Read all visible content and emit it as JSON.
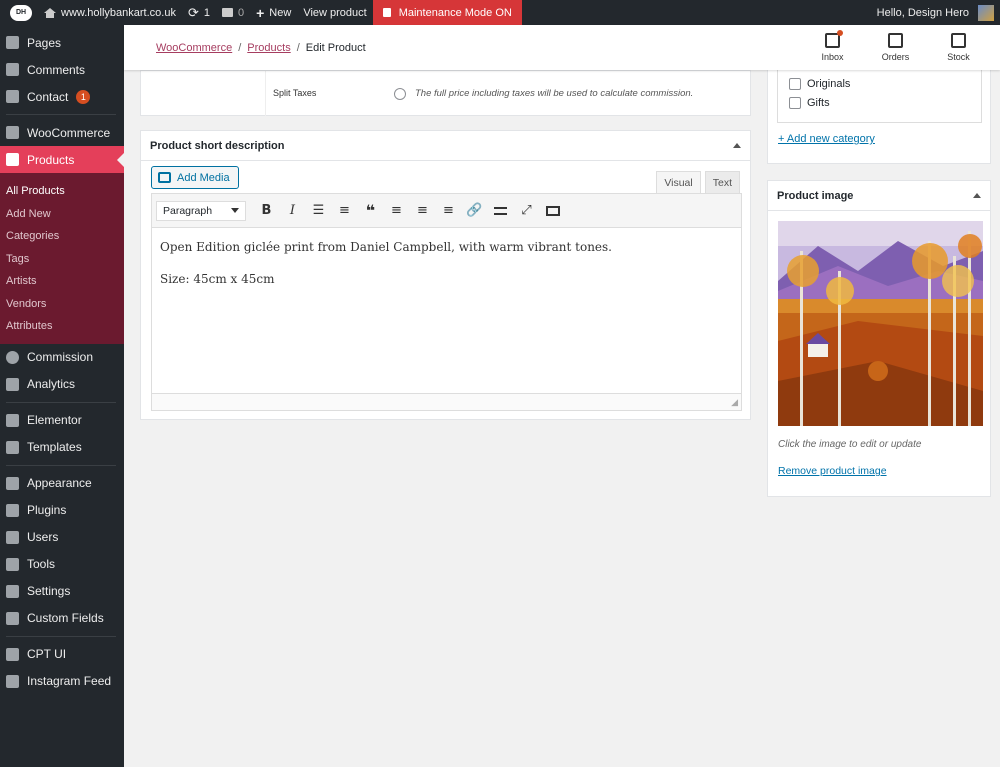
{
  "adminbar": {
    "site": "www.hollybankart.co.uk",
    "updates": "1",
    "comments": "0",
    "new_label": "New",
    "view_product": "View product",
    "maintenance": "Maintenance Mode ON",
    "greeting": "Hello, Design Hero"
  },
  "sidebar": {
    "items": [
      {
        "label": "Pages"
      },
      {
        "label": "Comments"
      },
      {
        "label": "Contact",
        "badge": "1"
      },
      {
        "label": "WooCommerce"
      },
      {
        "label": "Products"
      },
      {
        "label": "Commission"
      },
      {
        "label": "Analytics"
      },
      {
        "label": "Elementor"
      },
      {
        "label": "Templates"
      },
      {
        "label": "Appearance"
      },
      {
        "label": "Plugins"
      },
      {
        "label": "Users"
      },
      {
        "label": "Tools"
      },
      {
        "label": "Settings"
      },
      {
        "label": "Custom Fields"
      },
      {
        "label": "CPT UI"
      },
      {
        "label": "Instagram Feed"
      }
    ],
    "submenu": [
      "All Products",
      "Add New",
      "Categories",
      "Tags",
      "Artists",
      "Vendors",
      "Attributes"
    ]
  },
  "header": {
    "breadcrumb": [
      "WooCommerce",
      "Products",
      "Edit Product"
    ],
    "icons": [
      "Inbox",
      "Orders",
      "Stock"
    ]
  },
  "split_taxes": {
    "label": "Split Taxes",
    "description": "The full price including taxes will be used to calculate commission."
  },
  "short_description": {
    "title": "Product short description",
    "add_media": "Add Media",
    "tab_visual": "Visual",
    "tab_text": "Text",
    "format": "Paragraph",
    "paragraphs": [
      "Open Edition giclée print from Daniel Campbell, with warm vibrant tones.",
      "Size: 45cm x 45cm"
    ]
  },
  "categories": {
    "items": [
      "Originals",
      "Gifts"
    ],
    "add_new": "+ Add new category"
  },
  "product_image": {
    "title": "Product image",
    "hint": "Click the image to edit or update",
    "remove": "Remove product image"
  },
  "colors": {
    "admin_bg": "#23282d",
    "accent": "#e43f5a",
    "submenu_bg": "#6b1a2f",
    "link": "#0073aa",
    "maintenance": "#d63638"
  }
}
